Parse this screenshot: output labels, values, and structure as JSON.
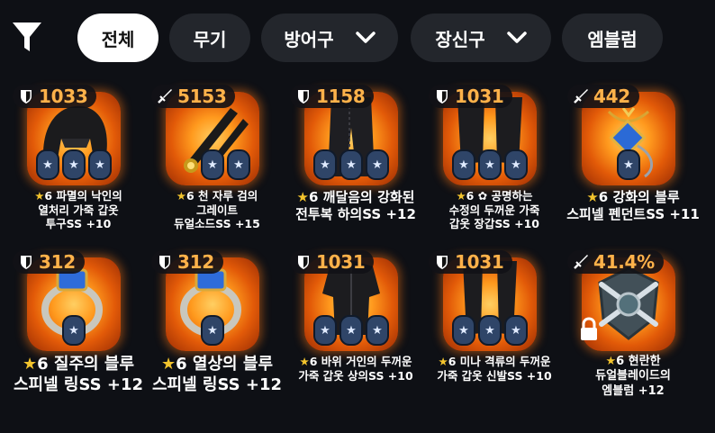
{
  "tabs": [
    {
      "label": "전체",
      "active": true
    },
    {
      "label": "무기",
      "active": false
    },
    {
      "label": "방어구",
      "active": false,
      "dropdown": true
    },
    {
      "label": "장신구",
      "active": false,
      "dropdown": true
    },
    {
      "label": "엠블럼",
      "active": false
    }
  ],
  "items": [
    {
      "stat_type": "shield-icon",
      "stat": "1033",
      "sockets": 3,
      "name_line1": "★6 파멸의 낙인의",
      "name_line2": "열처리 가죽 갑옷",
      "name_line3": "투구SS +10",
      "art": "helmet",
      "locked": false
    },
    {
      "stat_type": "sword-icon",
      "stat": "5153",
      "sockets": 2,
      "name_line1": "★6 천 자루 검의",
      "name_line2": "그레이트",
      "name_line3": "듀얼소드SS +15",
      "art": "dual-swords",
      "locked": false
    },
    {
      "stat_type": "shield-icon",
      "stat": "1158",
      "sockets": 3,
      "name_line1": "★6 깨달음의 강화된",
      "name_line2": "전투복 하의SS +12",
      "name_line3": "",
      "art": "pants",
      "locked": false
    },
    {
      "stat_type": "shield-icon",
      "stat": "1031",
      "sockets": 3,
      "name_line1": "★6 ✿ 공명하는",
      "name_line2": "수정의 두꺼운 가죽",
      "name_line3": "갑옷 장갑SS +10",
      "art": "gloves",
      "locked": false
    },
    {
      "stat_type": "sword-icon",
      "stat": "442",
      "sockets": 1,
      "name_line1": "★6 강화의 블루",
      "name_line2": "스피넬 펜던트SS +11",
      "name_line3": "",
      "art": "pendant",
      "locked": false
    },
    {
      "stat_type": "shield-icon",
      "stat": "312",
      "sockets": 1,
      "name_line1": "★6 질주의 블루",
      "name_line2": "스피넬 링SS +12",
      "name_line3": "",
      "art": "ring",
      "locked": false
    },
    {
      "stat_type": "shield-icon",
      "stat": "312",
      "sockets": 1,
      "name_line1": "★6 열상의 블루",
      "name_line2": "스피넬 링SS +12",
      "name_line3": "",
      "art": "ring",
      "locked": false
    },
    {
      "stat_type": "shield-icon",
      "stat": "1031",
      "sockets": 3,
      "name_line1": "★6 바위 거인의 두꺼운",
      "name_line2": "가죽 갑옷 상의SS +10",
      "name_line3": "",
      "art": "chest",
      "locked": false
    },
    {
      "stat_type": "shield-icon",
      "stat": "1031",
      "sockets": 3,
      "name_line1": "★6 미나 격류의 두꺼운",
      "name_line2": "가죽 갑옷 신발SS +10",
      "name_line3": "",
      "art": "boots",
      "locked": false
    },
    {
      "stat_type": "sword-icon",
      "stat": "41.4%",
      "sockets": 0,
      "name_line1": "★6 현란한",
      "name_line2": "듀얼블레이드의",
      "name_line3": "엠블럼 +12",
      "art": "emblem",
      "locked": true
    }
  ],
  "colors": {
    "background": "#0e1015",
    "tab": "#23262c",
    "stat": "#ffb24a",
    "star": "#f3c42d",
    "socket": "#2f4568"
  }
}
